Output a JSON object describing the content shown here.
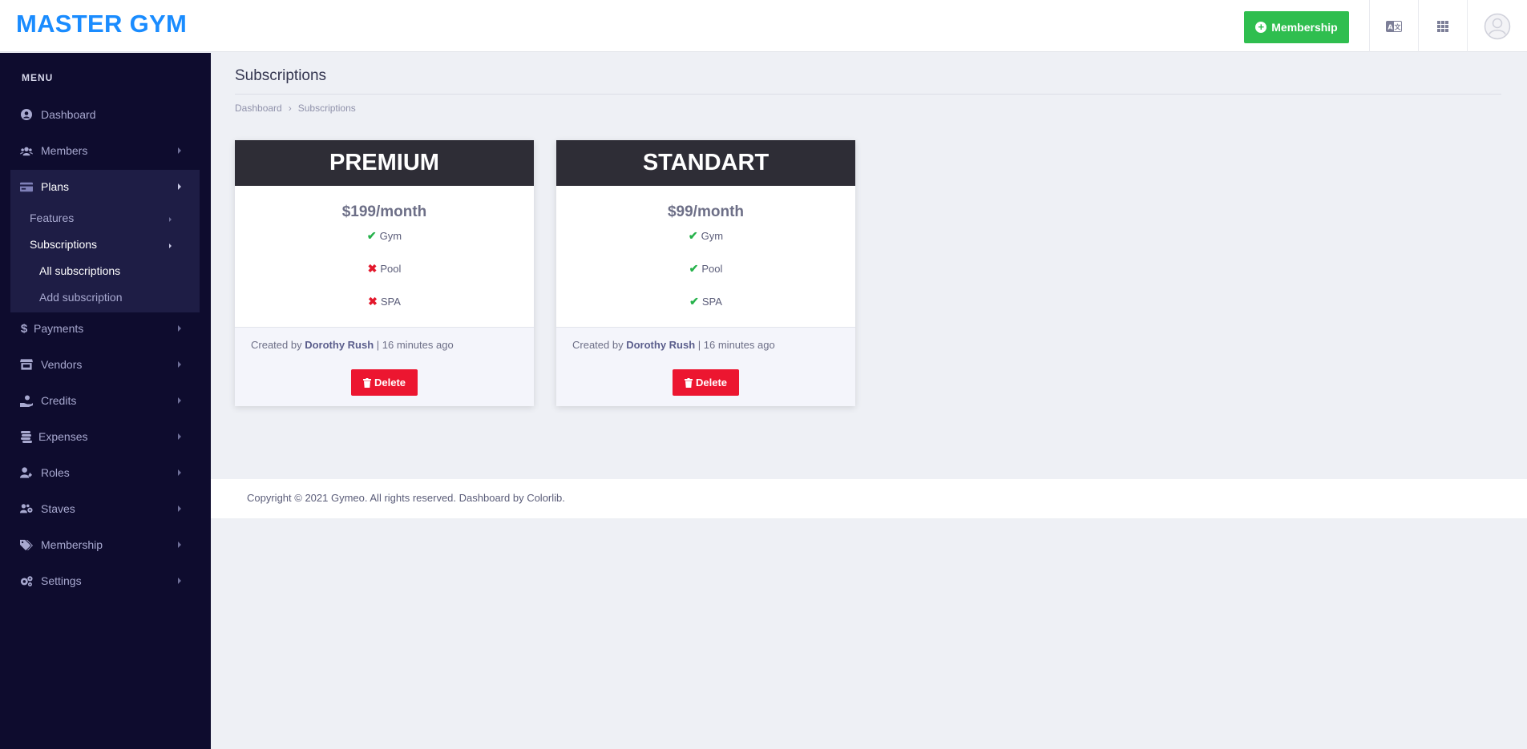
{
  "brand": "MASTER GYM",
  "header": {
    "membership_button": "Membership",
    "icons": [
      "translate-icon",
      "apps-grid-icon",
      "user-avatar-icon"
    ]
  },
  "sidebar": {
    "menu_title": "MENU",
    "items": [
      {
        "label": "Dashboard",
        "icon": "user-circle-icon"
      },
      {
        "label": "Members",
        "icon": "users-icon"
      },
      {
        "label": "Plans",
        "icon": "card-icon"
      },
      {
        "label": "Payments",
        "icon": "dollar-icon"
      },
      {
        "label": "Vendors",
        "icon": "store-icon"
      },
      {
        "label": "Credits",
        "icon": "hand-coin-icon"
      },
      {
        "label": "Expenses",
        "icon": "coins-icon"
      },
      {
        "label": "Roles",
        "icon": "user-edit-icon"
      },
      {
        "label": "Staves",
        "icon": "users-gear-icon"
      },
      {
        "label": "Membership",
        "icon": "tags-icon"
      },
      {
        "label": "Settings",
        "icon": "gears-icon"
      }
    ],
    "plans_sub": {
      "features": "Features",
      "subscriptions": "Subscriptions",
      "all_subscriptions": "All subscriptions",
      "add_subscription": "Add subscription"
    }
  },
  "page": {
    "title": "Subscriptions",
    "breadcrumb": [
      "Dashboard",
      "Subscriptions"
    ]
  },
  "cards": [
    {
      "name": "PREMIUM",
      "price": "$199/month",
      "features": [
        {
          "label": "Gym",
          "included": true
        },
        {
          "label": "Pool",
          "included": false
        },
        {
          "label": "SPA",
          "included": false
        }
      ],
      "created_prefix": "Created by",
      "author": "Dorothy Rush",
      "created_suffix": "| 16 minutes ago",
      "delete_label": "Delete"
    },
    {
      "name": "STANDART",
      "price": "$99/month",
      "features": [
        {
          "label": "Gym",
          "included": true
        },
        {
          "label": "Pool",
          "included": true
        },
        {
          "label": "SPA",
          "included": true
        }
      ],
      "created_prefix": "Created by",
      "author": "Dorothy Rush",
      "created_suffix": "| 16 minutes ago",
      "delete_label": "Delete"
    }
  ],
  "footer": {
    "text": "Copyright © 2021 Gymeo. All rights reserved. Dashboard by Colorlib."
  },
  "colors": {
    "brand": "#1a8cff",
    "success": "#2fbe4f",
    "danger": "#ec1630",
    "sidebar_bg": "#0e0c2e",
    "card_header": "#2e2d36"
  }
}
